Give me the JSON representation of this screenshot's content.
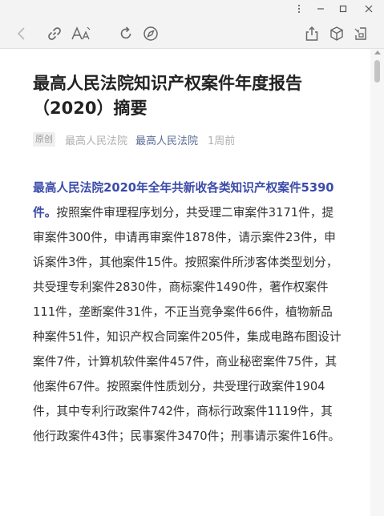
{
  "window": {
    "minimize_glyph": "⋮",
    "icons": {
      "menu": "more-vertical-icon",
      "minimize": "minimize-icon",
      "maximize": "maximize-icon",
      "close": "close-icon"
    }
  },
  "toolbar": {
    "icons": [
      "back-arrow-icon",
      "copy-link-icon",
      "font-size-icon",
      "refresh-icon",
      "compass-icon",
      "share-icon",
      "cube-icon",
      "pip-icon"
    ]
  },
  "article": {
    "title": "最高人民法院知识产权案件年度报告（2020）摘要",
    "badge": "原创",
    "author": "最高人民法院",
    "account": "最高人民法院",
    "time": "1周前",
    "highlight": "最高人民法院2020年全年共新收各类知识产权案件5390件。",
    "body": "按照案件审理程序划分，共受理二审案件3171件，提审案件300件，申请再审案件1878件，请示案件23件，申诉案件3件，其他案件15件。按照案件所涉客体类型划分，共受理专利案件2830件，商标案件1490件，著作权案件111件，垄断案件31件，不正当竞争案件66件，植物新品种案件51件，知识产权合同案件205件，集成电路布图设计案件7件，计算机软件案件457件，商业秘密案件75件，其他案件67件。按照案件性质划分，共受理行政案件1904件，其中专利行政案件742件，商标行政案件1119件，其他行政案件43件；民事案件3470件；刑事请示案件16件。"
  },
  "colors": {
    "highlight": "#3b4ba9",
    "account_link": "#576b95",
    "title": "#222222",
    "body": "#333333",
    "muted": "#b0b0b0"
  }
}
